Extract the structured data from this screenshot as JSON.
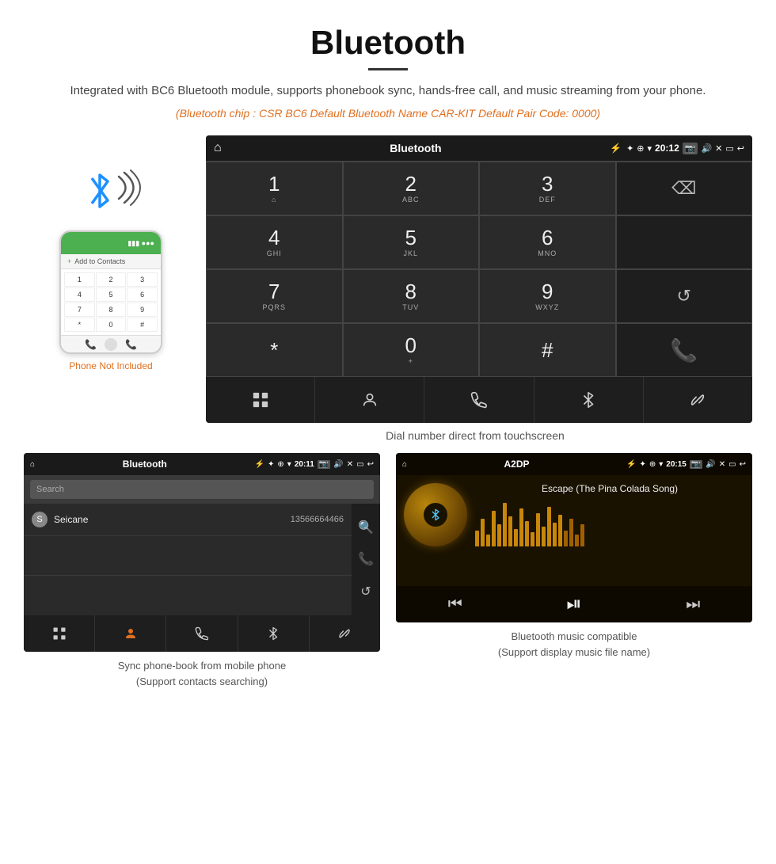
{
  "title": "Bluetooth",
  "subtitle": "Integrated with BC6 Bluetooth module, supports phonebook sync, hands-free call, and music streaming from your phone.",
  "specs": "(Bluetooth chip : CSR BC6    Default Bluetooth Name CAR-KIT    Default Pair Code: 0000)",
  "dialpad": {
    "screen_title": "Bluetooth",
    "time": "20:12",
    "keys": [
      {
        "num": "1",
        "sub": ""
      },
      {
        "num": "2",
        "sub": "ABC"
      },
      {
        "num": "3",
        "sub": "DEF"
      },
      {
        "num": "",
        "sub": "",
        "type": "backspace"
      },
      {
        "num": "4",
        "sub": "GHI"
      },
      {
        "num": "5",
        "sub": "JKL"
      },
      {
        "num": "6",
        "sub": "MNO"
      },
      {
        "num": "",
        "sub": "",
        "type": "empty"
      },
      {
        "num": "7",
        "sub": "PQRS"
      },
      {
        "num": "8",
        "sub": "TUV"
      },
      {
        "num": "9",
        "sub": "WXYZ"
      },
      {
        "num": "",
        "sub": "",
        "type": "redial"
      },
      {
        "num": "*",
        "sub": ""
      },
      {
        "num": "0",
        "sub": "+"
      },
      {
        "num": "#",
        "sub": ""
      },
      {
        "num": "",
        "sub": "",
        "type": "call-green"
      },
      {
        "num": "",
        "sub": "",
        "type": "empty-bottom"
      },
      {
        "num": "",
        "sub": "",
        "type": "empty-bottom"
      },
      {
        "num": "",
        "sub": "",
        "type": "empty-bottom"
      },
      {
        "num": "",
        "sub": "",
        "type": "empty-bottom"
      },
      {
        "num": "",
        "sub": "",
        "type": "hangup"
      }
    ],
    "action_icons": [
      "grid",
      "person",
      "phone",
      "bluetooth",
      "link"
    ],
    "caption": "Dial number direct from touchscreen"
  },
  "phone_area": {
    "not_included_label": "Phone Not Included",
    "numpad_keys": [
      "1",
      "2",
      "3",
      "4",
      "5",
      "6",
      "7",
      "8",
      "9",
      "*",
      "0",
      "#"
    ]
  },
  "phonebook": {
    "screen_title": "Bluetooth",
    "time": "20:11",
    "search_placeholder": "Search",
    "contact_letter": "S",
    "contact_name": "Seicane",
    "contact_number": "13566664466",
    "caption_line1": "Sync phone-book from mobile phone",
    "caption_line2": "(Support contacts searching)"
  },
  "music": {
    "screen_title": "A2DP",
    "time": "20:15",
    "song_title": "Escape (The Pina Colada Song)",
    "caption_line1": "Bluetooth music compatible",
    "caption_line2": "(Support display music file name)"
  }
}
